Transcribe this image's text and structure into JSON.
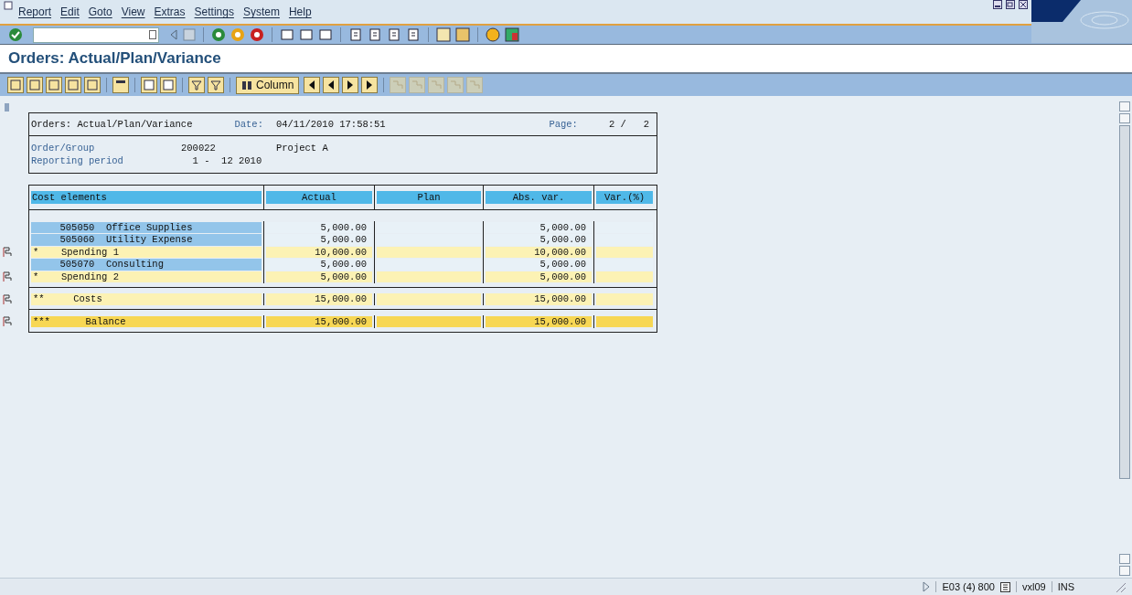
{
  "menu": [
    "Report",
    "Edit",
    "Goto",
    "View",
    "Extras",
    "Settings",
    "System",
    "Help"
  ],
  "title": "Orders: Actual/Plan/Variance",
  "app_toolbar": {
    "column_button": "Column"
  },
  "report_header": {
    "title": "Orders: Actual/Plan/Variance",
    "date_label": "Date:",
    "date": "04/11/2010 17:58:51",
    "page_label": "Page:",
    "page": "2 /   2",
    "fields": [
      {
        "label": "Order/Group",
        "value": "200022",
        "extra": "Project A"
      },
      {
        "label": "Reporting period",
        "value": "  1 -  12 2010"
      }
    ]
  },
  "table": {
    "columns": [
      "Cost elements",
      "Actual",
      "Plan",
      "Abs. var.",
      "Var.(%)"
    ],
    "sections": [
      [
        {
          "kind": "item",
          "code": "505050",
          "label": "Office Supplies",
          "actual": "5,000.00",
          "abs_var": "5,000.00"
        },
        {
          "kind": "item",
          "code": "505060",
          "label": "Utility Expense",
          "actual": "5,000.00",
          "abs_var": "5,000.00"
        },
        {
          "kind": "subtotal",
          "marker": "*",
          "label": "Spending 1",
          "actual": "10,000.00",
          "abs_var": "10,000.00"
        },
        {
          "kind": "item",
          "code": "505070",
          "label": "Consulting",
          "actual": "5,000.00",
          "abs_var": "5,000.00"
        },
        {
          "kind": "subtotal",
          "marker": "*",
          "label": "Spending 2",
          "actual": "5,000.00",
          "abs_var": "5,000.00"
        }
      ],
      [
        {
          "kind": "subtotal",
          "marker": "**",
          "label": "Costs",
          "actual": "15,000.00",
          "abs_var": "15,000.00"
        }
      ],
      [
        {
          "kind": "total",
          "marker": "***",
          "label": "Balance",
          "actual": "15,000.00",
          "abs_var": "15,000.00"
        }
      ]
    ]
  },
  "status_bar": {
    "system": "E03 (4) 800",
    "server": "vxl09",
    "mode": "INS"
  }
}
